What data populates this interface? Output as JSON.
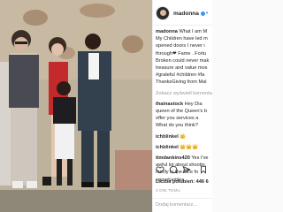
{
  "post": {
    "username": "madonna",
    "follow_dot": "•",
    "caption_user": "madonna",
    "caption_lines": [
      "What I am M",
      "My Children have led m",
      "opened doors I never i",
      "through❤ Fame . Fortu",
      "Broken could never mak",
      "treasure and value mos",
      "#grateful #children #fa",
      "ThanksGiving from Mal"
    ],
    "translation_link": "Zobacz wyświetl komentarz",
    "comments": [
      {
        "user": "thainastock",
        "lines": [
          "Hey Dia",
          "queen of the Queen's b",
          "offer you services a",
          "What do you think?"
        ]
      },
      {
        "user": "ichblinkel",
        "lines": [
          "👑"
        ]
      },
      {
        "user": "ichblinkel",
        "lines": [
          "👑👑👑"
        ]
      },
      {
        "user": "timdankins420",
        "lines": [
          "Yes I've",
          "awful lot about shootin",
          "family in the face fo",
          "opportunities"
        ]
      }
    ],
    "likes_text": "Liczba polubień: 446 6",
    "date_text": "3 DNI TEMU",
    "add_comment_placeholder": "Dodaj komentarz..."
  },
  "icons": [
    "heart-icon",
    "comment-icon",
    "share-icon",
    "bookmark-icon"
  ],
  "colors": {
    "accent": "#3897f0",
    "text": "#262626",
    "muted": "#999999"
  }
}
